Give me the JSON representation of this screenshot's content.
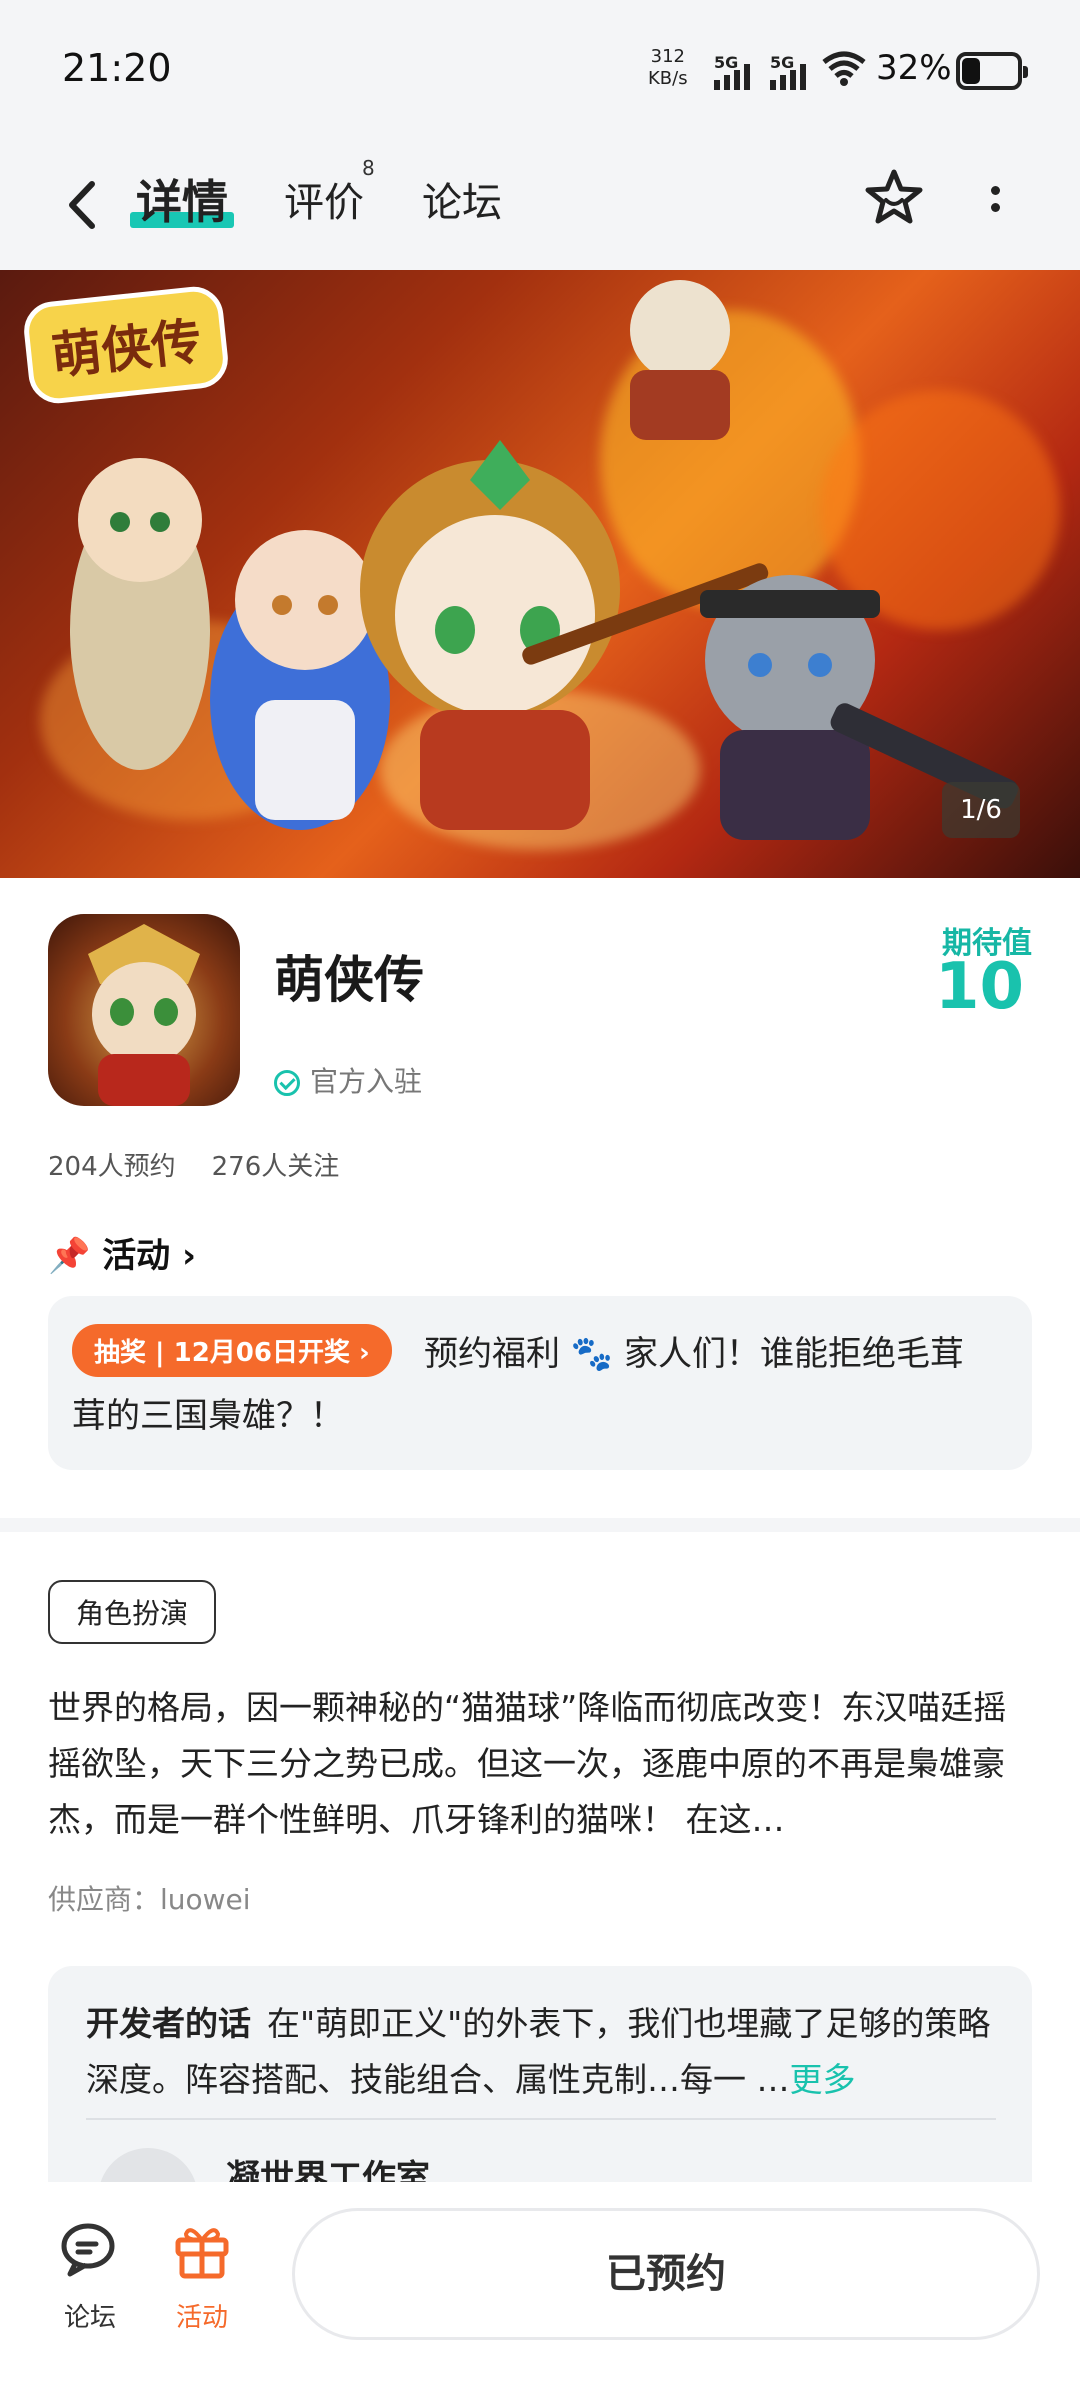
{
  "status_bar": {
    "time": "21:20",
    "net_speed_value": "312",
    "net_speed_unit": "KB/s",
    "signal1": "5G",
    "signal2": "5G",
    "battery": "32%"
  },
  "nav": {
    "tabs": [
      {
        "label": "详情",
        "active": true
      },
      {
        "label": "评价",
        "badge": "8"
      },
      {
        "label": "论坛"
      }
    ]
  },
  "banner": {
    "logo_text": "萌侠传",
    "counter": "1/6"
  },
  "app": {
    "name": "萌侠传",
    "official_label": "官方入驻",
    "expect_label": "期待值",
    "expect_value": "10",
    "reservations": "204人预约",
    "followers": "276人关注"
  },
  "activity": {
    "heading": "活动",
    "badge": "抽奖 | 12月06日开奖",
    "text_line1": "预约福利 🐾 家人们！谁能拒绝毛茸",
    "text_line2": "茸的三国梟雄？！"
  },
  "details": {
    "tag": "角色扮演",
    "description": "世界的格局，因一颗神秘的“猫猫球”降临而彻底改变！东汉喵廷摇摇欲坠，天下三分之势已成。但这一次，逐鹿中原的不再是梟雄豪杰，而是一群个性鲜明、爪牙锋利的猫咪！ 在这…",
    "supplier": "供应商：luowei"
  },
  "developer": {
    "label": "开发者的话",
    "text": "在\"萌即正义\"的外表下，我们也埋藏了足够的策略深度。阵容搭配、技能组合、属性克制…每一 …",
    "more": "更多",
    "studio": "凝世界工作室"
  },
  "bottom_bar": {
    "forum_label": "论坛",
    "activity_label": "活动",
    "reserve_label": "已预约"
  },
  "colors": {
    "accent": "#19c2ad",
    "orange": "#f56a2b"
  }
}
